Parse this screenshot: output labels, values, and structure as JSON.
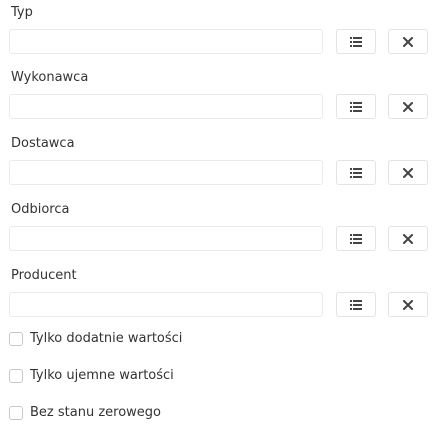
{
  "fields": [
    {
      "label": "Typ",
      "value": "",
      "list_icon": "list-icon",
      "clear_icon": "close-icon"
    },
    {
      "label": "Wykonawca",
      "value": "",
      "list_icon": "list-icon",
      "clear_icon": "close-icon"
    },
    {
      "label": "Dostawca",
      "value": "",
      "list_icon": "list-icon",
      "clear_icon": "close-icon"
    },
    {
      "label": "Odbiorca",
      "value": "",
      "list_icon": "list-icon",
      "clear_icon": "close-icon"
    },
    {
      "label": "Producent",
      "value": "",
      "list_icon": "list-icon",
      "clear_icon": "close-icon"
    }
  ],
  "checkboxes": [
    {
      "label": "Tylko dodatnie wartości",
      "checked": false
    },
    {
      "label": "Tylko ujemne wartości",
      "checked": false
    },
    {
      "label": "Bez stanu zerowego",
      "checked": false
    }
  ],
  "colors": {
    "text": "#333333",
    "border": "#e3e3e3",
    "icon": "#444444"
  }
}
